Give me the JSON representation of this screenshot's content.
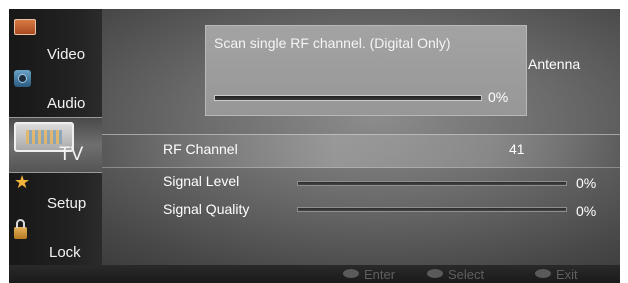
{
  "sidebar": {
    "items": [
      {
        "label": "Video",
        "icon": "video-icon"
      },
      {
        "label": "Audio",
        "icon": "speaker-icon"
      },
      {
        "label": "TV",
        "icon": "tv-icon",
        "active": true
      },
      {
        "label": "Setup",
        "icon": "star-icon"
      },
      {
        "label": "Lock",
        "icon": "padlock-icon"
      }
    ]
  },
  "scan": {
    "message": "Scan single RF channel. (Digital Only)",
    "progress_text": "0%",
    "progress": 0,
    "source": "Antenna"
  },
  "rows": {
    "rf_channel": {
      "label": "RF Channel",
      "value": "41"
    },
    "signal_level": {
      "label": "Signal Level",
      "value": "0%",
      "level": 0
    },
    "signal_quality": {
      "label": "Signal Quality",
      "value": "0%",
      "level": 0
    }
  },
  "hints": {
    "enter": "Enter",
    "select": "Select",
    "exit": "Exit"
  },
  "colors": {
    "text": "#ffffff",
    "hint_text": "#5f5f5f",
    "accent_star": "#f2b43a"
  }
}
